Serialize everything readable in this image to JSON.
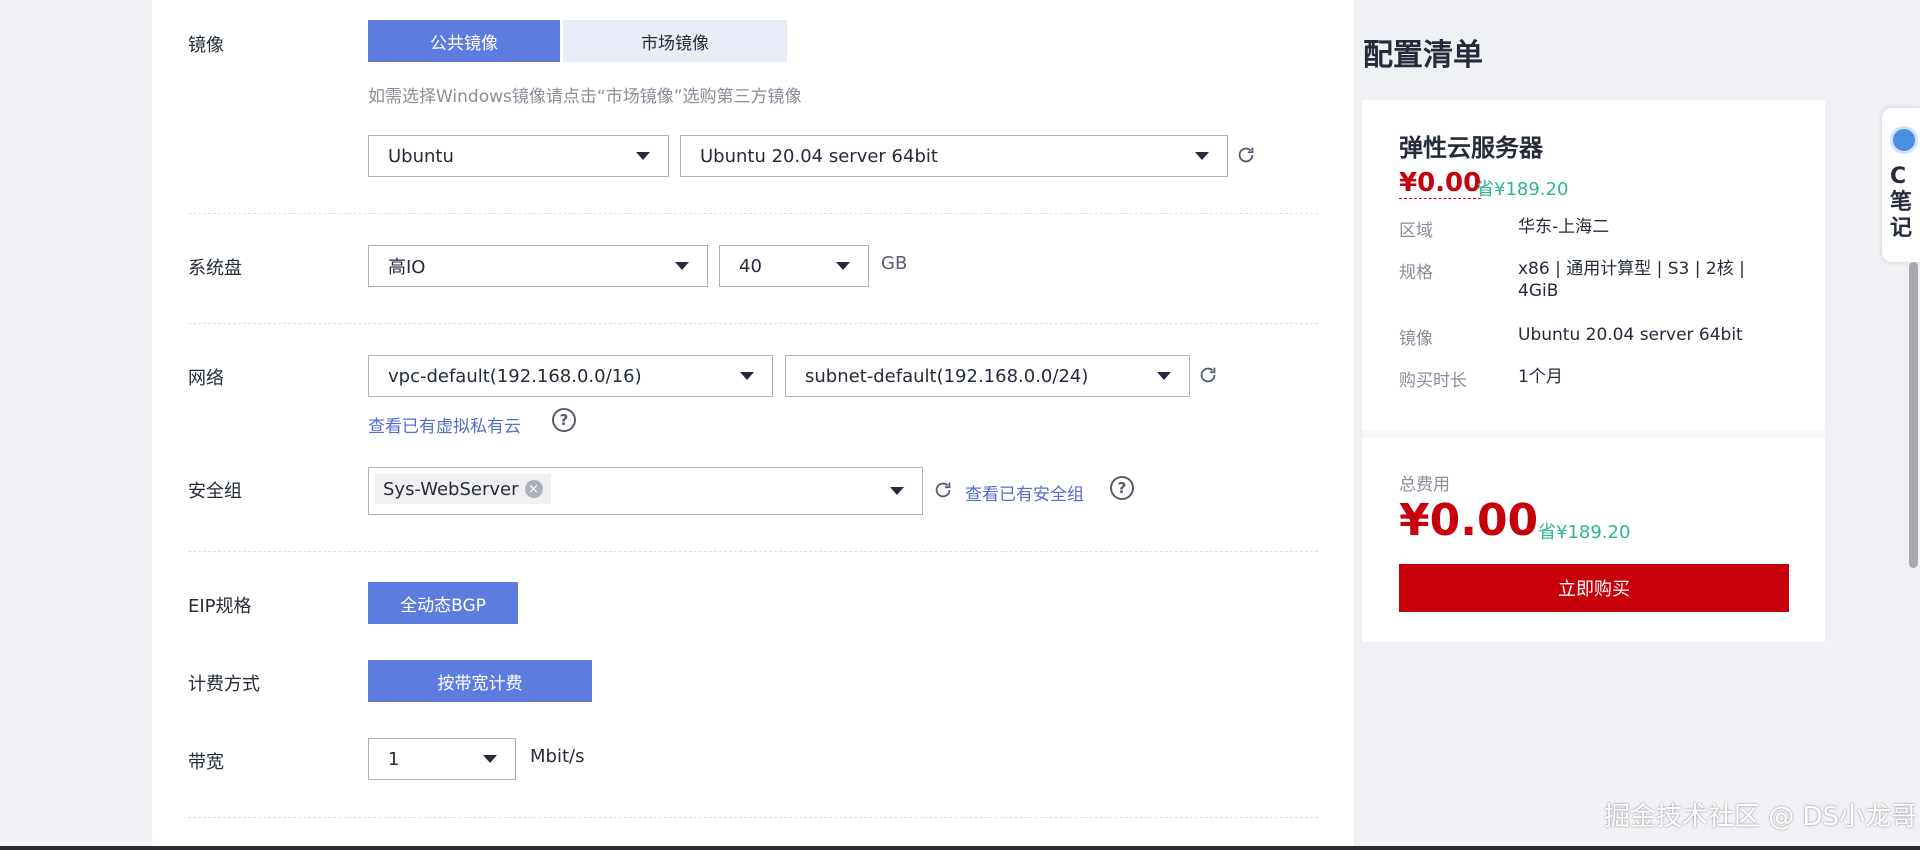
{
  "image": {
    "label": "镜像",
    "tabs": [
      "公共镜像",
      "市场镜像"
    ],
    "hint": "如需选择Windows镜像请点击“市场镜像”选购第三方镜像",
    "os": "Ubuntu",
    "version": "Ubuntu 20.04 server 64bit"
  },
  "disk": {
    "label": "系统盘",
    "type": "高IO",
    "size": "40",
    "unit": "GB"
  },
  "network": {
    "label": "网络",
    "vpc": "vpc-default(192.168.0.0/16)",
    "subnet": "subnet-default(192.168.0.0/24)",
    "view_vpc_link": "查看已有虚拟私有云"
  },
  "security": {
    "label": "安全组",
    "tag": "Sys-WebServer",
    "view_link": "查看已有安全组"
  },
  "eip": {
    "label": "EIP规格",
    "value": "全动态BGP"
  },
  "billing": {
    "label": "计费方式",
    "value": "按带宽计费"
  },
  "bandwidth": {
    "label": "带宽",
    "value": "1",
    "unit": "Mbit/s"
  },
  "summary": {
    "title": "配置清单",
    "product": "弹性云服务器",
    "price": "¥0.00",
    "save": "省¥189.20",
    "specs": [
      {
        "key": "区域",
        "value": "华东-上海二"
      },
      {
        "key": "规格",
        "value": "x86 | 通用计算型 | S3 | 2核 | 4GiB"
      },
      {
        "key": "镜像",
        "value": "Ubuntu 20.04 server 64bit"
      },
      {
        "key": "购买时长",
        "value": "1个月"
      }
    ],
    "total_label": "总费用",
    "total_price": "¥0.00",
    "total_save": "省¥189.20",
    "buy_button": "立即购买"
  },
  "side_widget": {
    "letter": "C",
    "text": "笔记"
  },
  "watermark": "掘金技术社区 @ DS小龙哥",
  "colors": {
    "accent": "#5e7ce0",
    "price_red": "#c7000b",
    "save_green": "#2eb88a",
    "link": "#526ecc"
  }
}
